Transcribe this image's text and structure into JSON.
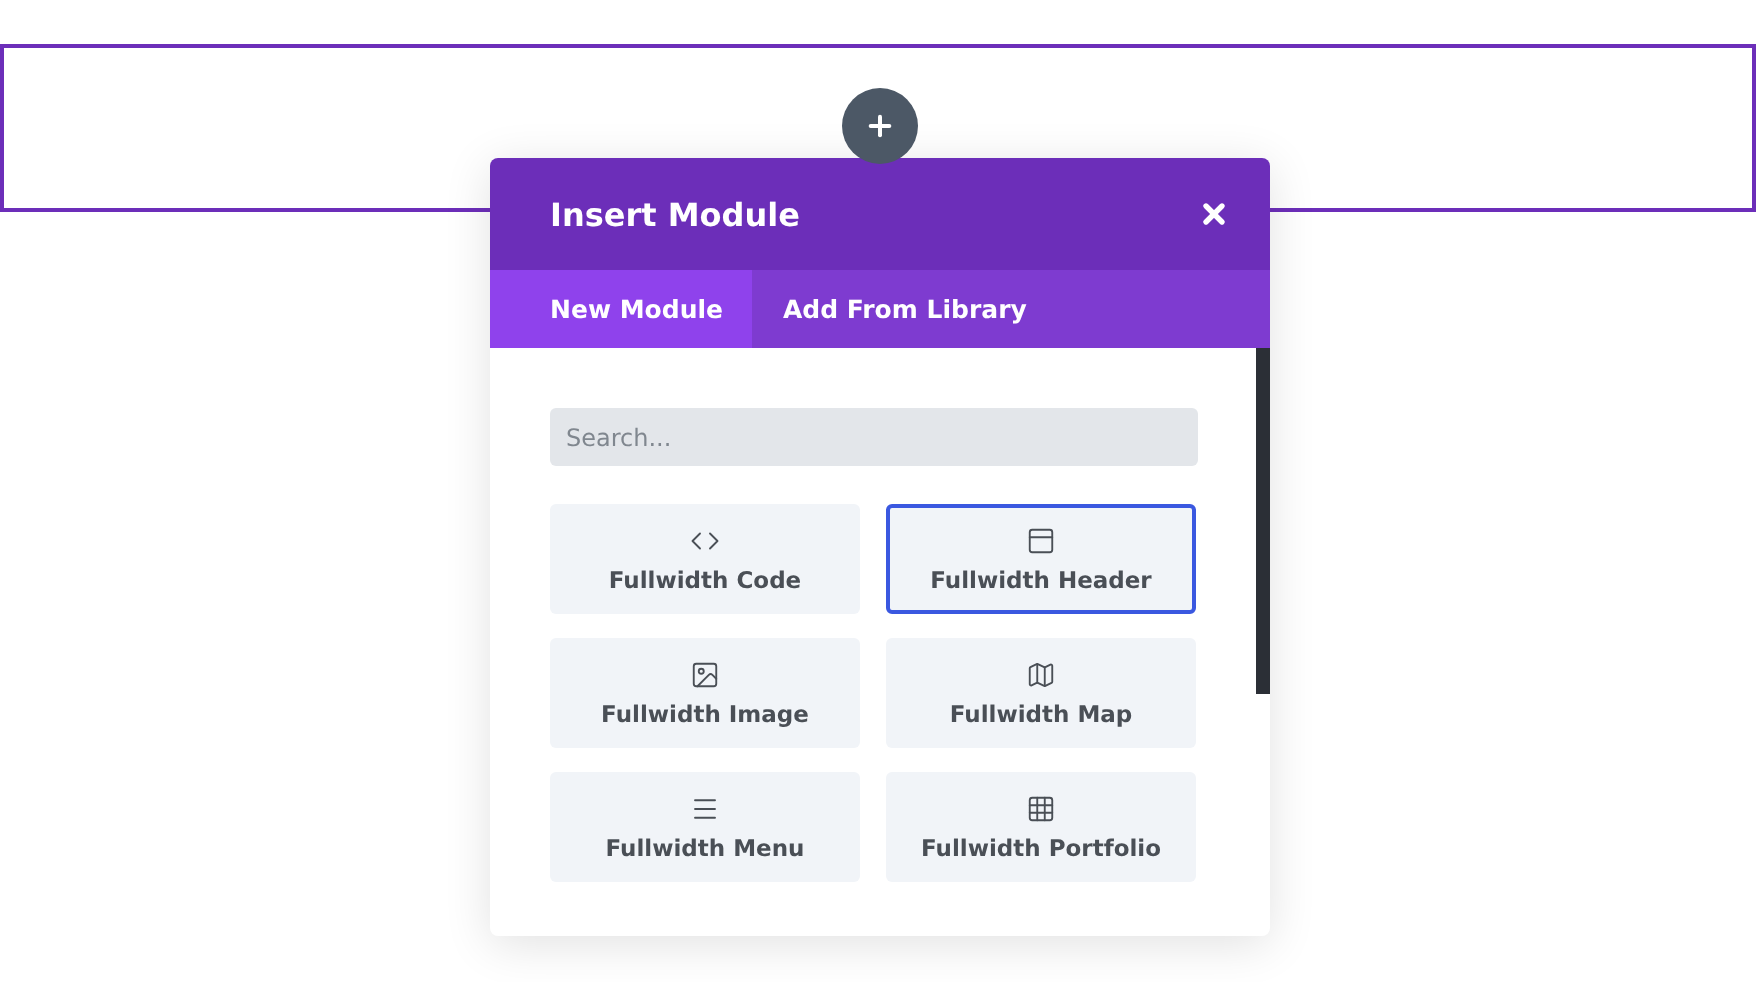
{
  "dialog": {
    "title": "Insert Module"
  },
  "tabs": [
    {
      "label": "New Module",
      "selected": true
    },
    {
      "label": "Add From Library",
      "selected": false
    }
  ],
  "search": {
    "placeholder": "Search..."
  },
  "modules": [
    {
      "label": "Fullwidth Code",
      "kind": "code",
      "selected": false
    },
    {
      "label": "Fullwidth Header",
      "kind": "header",
      "selected": true
    },
    {
      "label": "Fullwidth Image",
      "kind": "image",
      "selected": false
    },
    {
      "label": "Fullwidth Map",
      "kind": "map",
      "selected": false
    },
    {
      "label": "Fullwidth Menu",
      "kind": "menu",
      "selected": false
    },
    {
      "label": "Fullwidth Portfolio",
      "kind": "portfolio",
      "selected": false
    }
  ]
}
